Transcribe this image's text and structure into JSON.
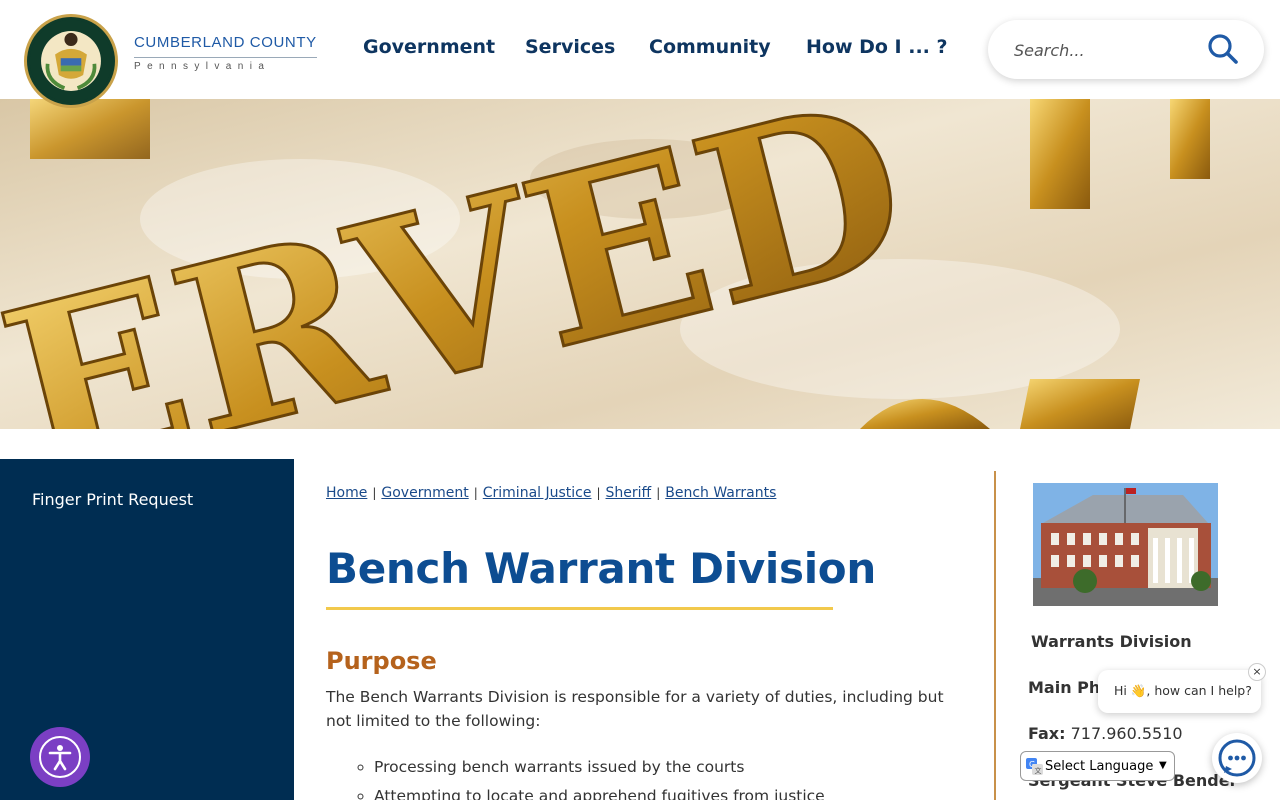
{
  "header": {
    "brand_name": "CUMBERLAND COUNTY",
    "brand_subtitle": "Pennsylvania",
    "seal_text": "COUNTY OF CUMBERLAND",
    "seal_year": "1750",
    "nav": [
      "Government",
      "Services",
      "Community",
      "How Do I ... ?"
    ],
    "search_placeholder": "Search..."
  },
  "banner": {
    "letters": "ERVED"
  },
  "sidebar": {
    "items": [
      {
        "label": "Finger Print Request"
      }
    ]
  },
  "breadcrumb": [
    "Home",
    "Government",
    "Criminal Justice",
    "Sheriff",
    "Bench Warrants"
  ],
  "main": {
    "title": "Bench Warrant Division",
    "section_heading": "Purpose",
    "paragraph": "The Bench Warrants Division is responsible for a variety of duties, including but not limited to the following:",
    "duties": [
      "Processing bench warrants issued by the courts",
      "Attempting to locate and apprehend fugitives from justice"
    ]
  },
  "contact": {
    "title": "Warrants Division",
    "main_phone_label": "Main Pho",
    "fax_label": "Fax:",
    "fax_value": "717.960.5510",
    "person": "Sergeant Steve Bender"
  },
  "chat": {
    "greeting": "Hi 👋, how can I help?",
    "close": "×"
  },
  "translate": {
    "label": "Select Language"
  },
  "colors": {
    "navy": "#002d52",
    "title_blue": "#0d4d92",
    "accent_gold": "#f2c94c",
    "heading_orange": "#b5621c",
    "divider": "#c8914a",
    "a11y_purple": "#7b3fc4"
  }
}
